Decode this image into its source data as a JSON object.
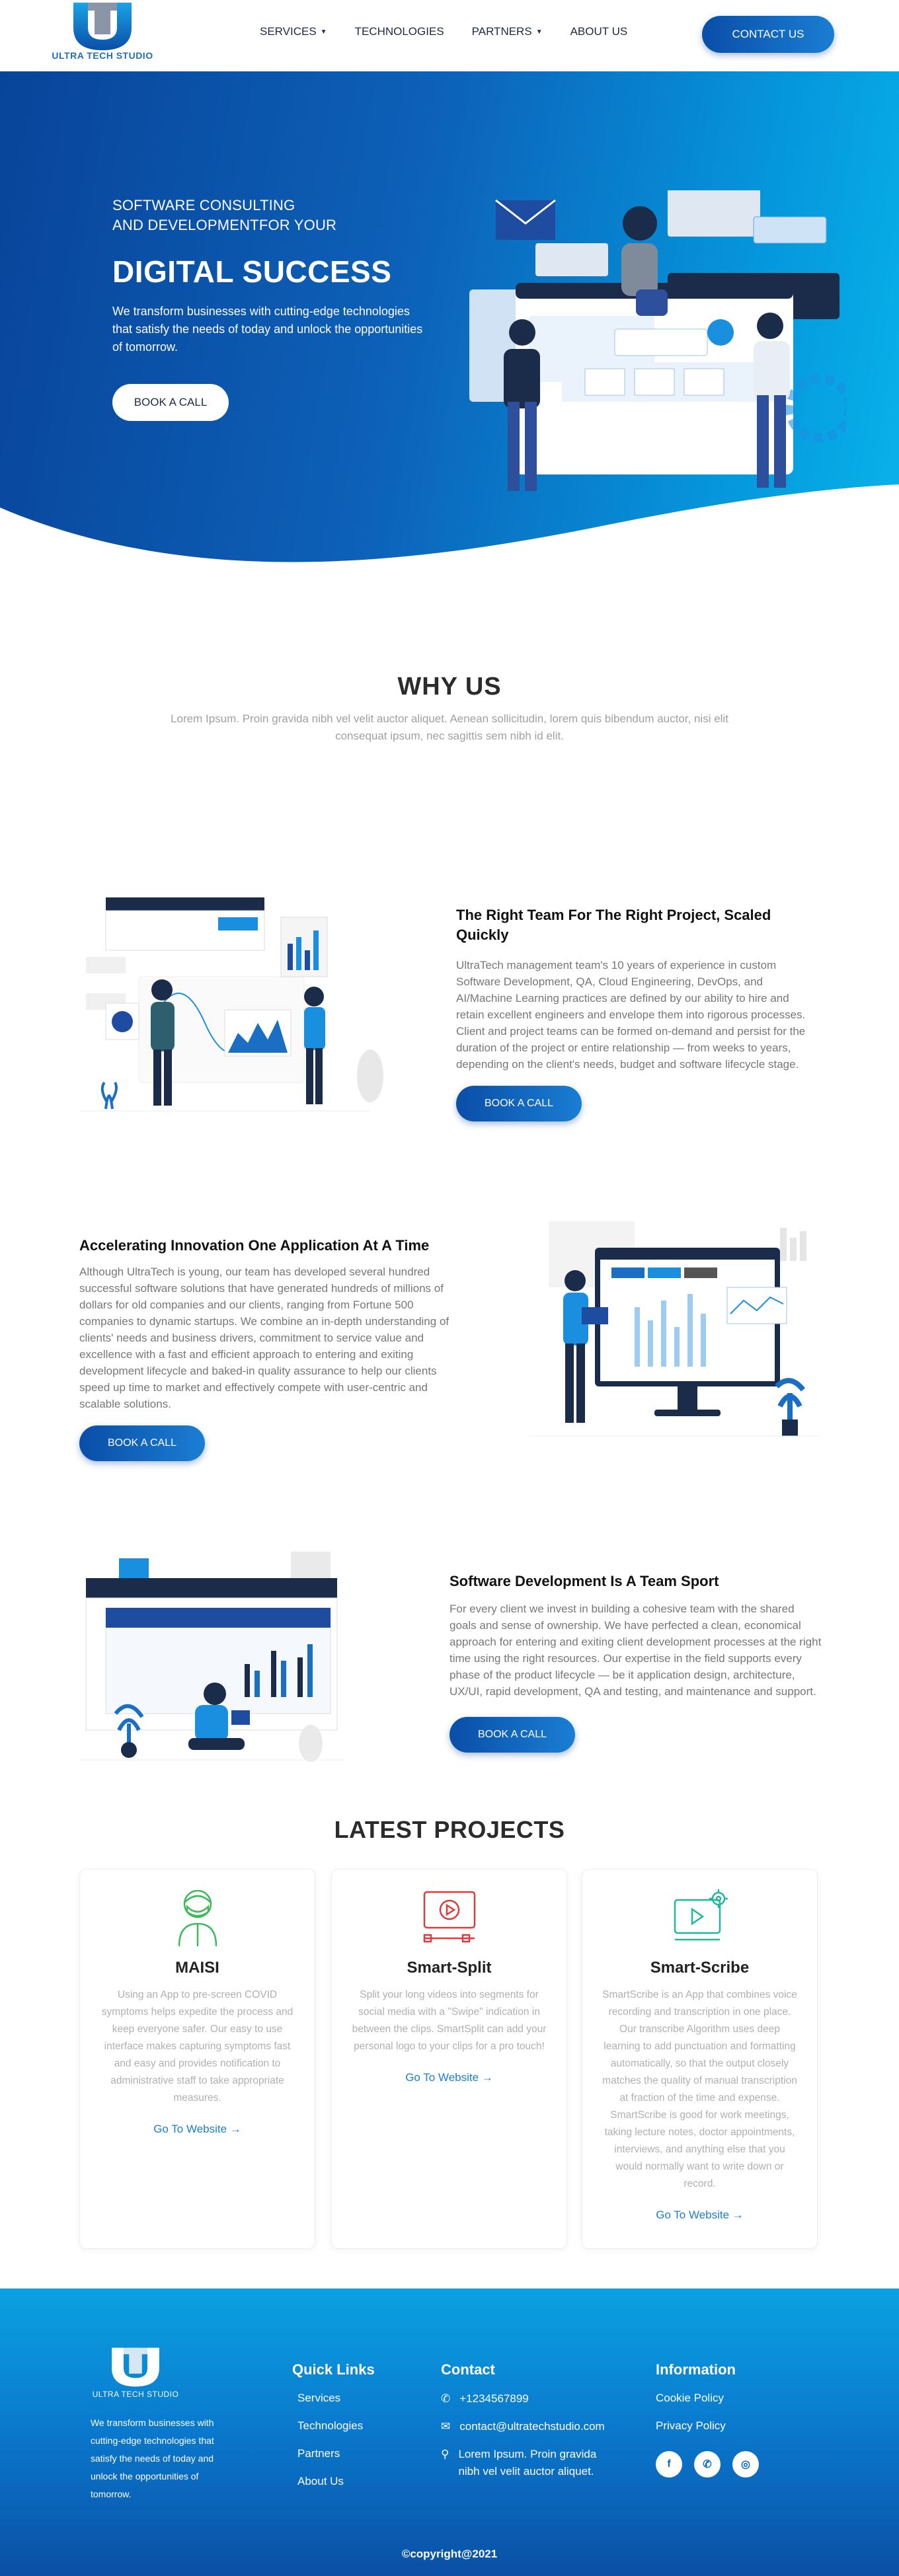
{
  "header": {
    "logo_text": "ULTRA TECH STUDIO",
    "nav": [
      {
        "label": "SERVICES",
        "dropdown": true
      },
      {
        "label": "TECHNOLOGIES",
        "dropdown": false
      },
      {
        "label": "PARTNERS",
        "dropdown": true
      },
      {
        "label": "ABOUT US",
        "dropdown": false
      }
    ],
    "cta": "CONTACT US"
  },
  "hero": {
    "pre_line1": "SOFTWARE CONSULTING",
    "pre_line2": "AND DEVELOPMENTFOR YOUR",
    "title": "DIGITAL SUCCESS",
    "desc": "We transform businesses with cutting-edge technologies that satisfy the needs of today and unlock the opportunities of tomorrow.",
    "button": "BOOK A CALL"
  },
  "why": {
    "title": "WHY US",
    "subtitle": "Lorem Ipsum. Proin gravida nibh vel velit auctor aliquet. Aenean sollicitudin, lorem quis bibendum auctor, nisi elit consequat ipsum, nec sagittis sem nibh id elit."
  },
  "features": [
    {
      "title": "The Right Team For The Right Project, Scaled Quickly",
      "text": "UltraTech management team's 10 years of experience in custom Software Development, QA, Cloud Engineering, DevOps, and AI/Machine Learning practices are defined by our ability to hire and retain excellent engineers and envelope them into rigorous processes. Client and project teams can be formed on-demand and persist for the duration of the project or entire relationship — from weeks to years, depending on the client's needs, budget and software lifecycle stage.",
      "button": "BOOK A CALL"
    },
    {
      "title": "Accelerating Innovation One Application At A Time",
      "text": "Although UltraTech is young, our team has developed several hundred successful software solutions that have generated hundreds of millions of dollars for old companies and our clients, ranging from Fortune 500 companies to dynamic startups. We combine an in-depth understanding of clients' needs and business drivers, commitment to service value and excellence with a fast and efficient approach to entering and exiting development lifecycle and baked-in quality assurance to help our clients speed up time to market and effectively compete with user-centric and scalable solutions.",
      "button": "BOOK A CALL"
    },
    {
      "title": "Software Development Is A Team Sport",
      "text": "For every client we invest in building a cohesive team with the shared goals and sense of ownership. We have perfected a clean, economical approach for entering and exiting client development processes at the right time using the right resources. Our expertise in the field supports every phase of the product lifecycle — be it application design, architecture, UX/UI, rapid development, QA and testing, and maintenance and support.",
      "button": "BOOK A CALL"
    }
  ],
  "projects": {
    "title": "LATEST PROJECTS",
    "items": [
      {
        "name": "MAISI",
        "desc": "Using an App to pre-screen COVID symptoms helps expedite the process and keep everyone safer. Our easy to use interface makes capturing symptoms fast and easy and provides notification to administrative staff to take appropriate measures.",
        "link": "Go To Website →",
        "icon": "masked-person-icon",
        "color": "#3dbb5a"
      },
      {
        "name": "Smart-Split",
        "desc": "Split your long videos into segments for social media with a \"Swipe\" indication in between the clips. SmartSplit can add your personal logo to your clips for a pro touch!",
        "link": "Go To Website →",
        "icon": "video-split-icon",
        "color": "#e03a3a"
      },
      {
        "name": "Smart-Scribe",
        "desc": "SmartScribe is an App that combines voice recording and transcription in one place. Our transcribe Algorithm uses deep learning to add punctuation and formatting automatically, so that the output closely matches the quality of manual transcription at fraction of the time and expense. SmartScribe is good for work meetings, taking lecture notes, doctor appointments, interviews, and anything else that you would normally want to write down or record.",
        "link": "Go To Website →",
        "icon": "video-gear-icon",
        "color": "#1fb89a"
      }
    ]
  },
  "footer": {
    "logo_text": "ULTRA TECH STUDIO",
    "desc": "We transform businesses with cutting-edge technologies that satisfy the needs of today and unlock the opportunities of tomorrow.",
    "quick_links_title": "Quick Links",
    "quick_links": [
      "Services",
      "Technologies",
      "Partners",
      "About Us"
    ],
    "contact_title": "Contact",
    "phone": "+1234567899",
    "email": "contact@ultratechstudio.com",
    "address": "Lorem Ipsum. Proin gravida nibh vel velit auctor aliquet.",
    "info_title": "Information",
    "info_links": [
      "Cookie Policy",
      "Privacy Policy"
    ],
    "social": [
      "facebook-icon",
      "whatsapp-icon",
      "instagram-icon"
    ],
    "copyright": "©copyright@2021"
  },
  "colors": {
    "primary": "#0a4ea8",
    "accent": "#1a7ed3",
    "light": "#08b3ea"
  }
}
